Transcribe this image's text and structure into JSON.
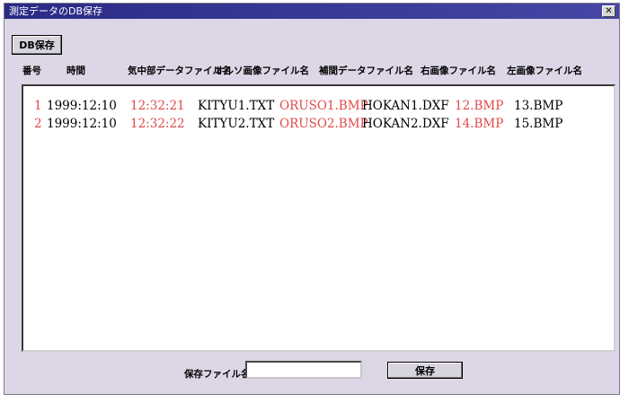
{
  "window": {
    "title": "測定データのDB保存",
    "close_label": "✕"
  },
  "toolbar": {
    "db_save_label": "DB保存"
  },
  "columns": [
    "番号",
    "時間",
    "気中部データファイル名",
    "オルソ画像ファイル名",
    "補間データファイル名",
    "右画像ファイル名",
    "左画像ファイル名"
  ],
  "rows": [
    {
      "no": "1",
      "date": "1999:12:10",
      "time": "12:32:21",
      "kityu": "KITYU1.TXT",
      "ortho": "ORUSO1.BMP",
      "hokan": "HOKAN1.DXF",
      "right": "12.BMP",
      "left": "13.BMP"
    },
    {
      "no": "2",
      "date": "1999:12:10",
      "time": "12:32:22",
      "kityu": "KITYU2.TXT",
      "ortho": "ORUSO2.BMP",
      "hokan": "HOKAN2.DXF",
      "right": "14.BMP",
      "left": "15.BMP"
    }
  ],
  "footer": {
    "filename_label": "保存ファイル名",
    "filename_value": "",
    "save_label": "保存"
  },
  "colors": {
    "title_bar": "#2a2a86",
    "dialog_bg": "#dcd6e6",
    "highlight_text": "#e04848"
  }
}
